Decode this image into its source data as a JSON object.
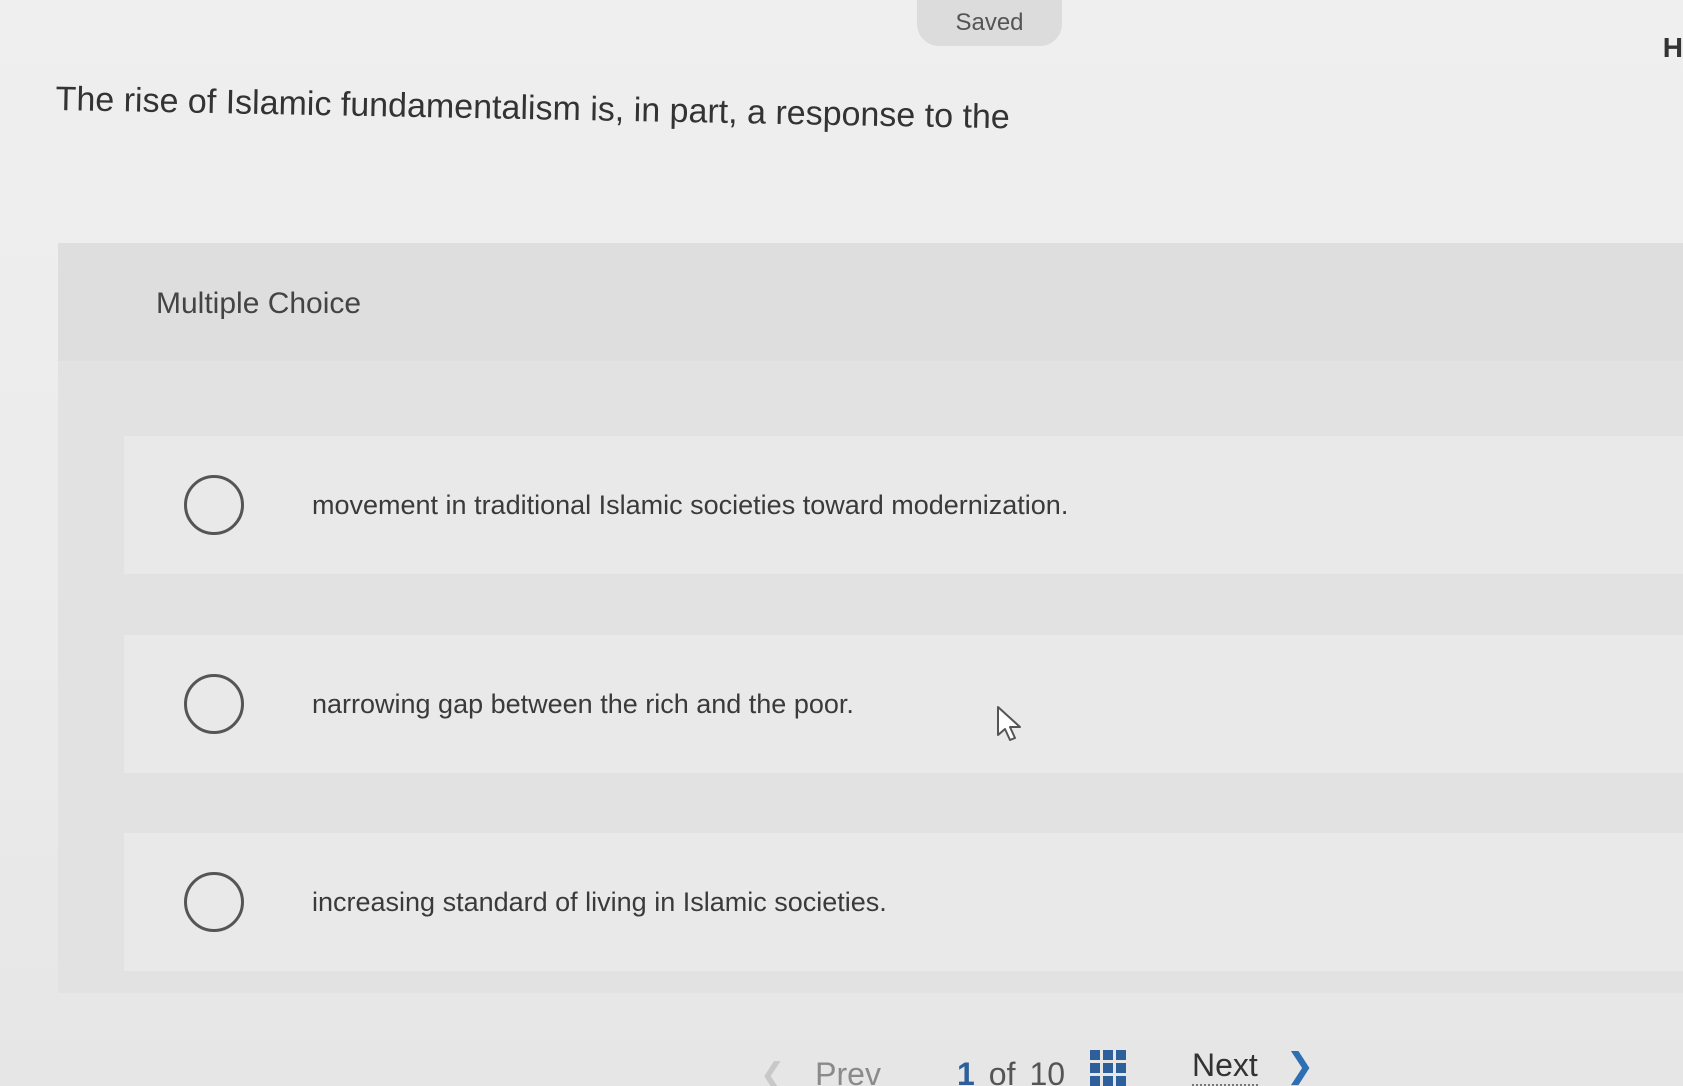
{
  "header": {
    "saved_label": "Saved",
    "corner_letter": "H"
  },
  "question": {
    "text": "The rise of Islamic fundamentalism is, in part, a response to the"
  },
  "choice_panel": {
    "type_label": "Multiple Choice",
    "options": [
      {
        "label": "movement in traditional Islamic societies toward modernization.",
        "selected": false
      },
      {
        "label": "narrowing gap between the rich and the poor.",
        "selected": false
      },
      {
        "label": "increasing standard of living in Islamic societies.",
        "selected": false
      }
    ]
  },
  "footer": {
    "prev_label": "Prev",
    "current_page": "1",
    "of_label": "of",
    "total_pages": "10",
    "next_label": "Next"
  },
  "colors": {
    "accent": "#2d5f9a",
    "next_chevron": "#2d6fb2",
    "background": "#ececec"
  },
  "icons": [
    "chevron-left-icon",
    "grid-icon",
    "chevron-right-icon",
    "mouse-pointer-icon"
  ]
}
